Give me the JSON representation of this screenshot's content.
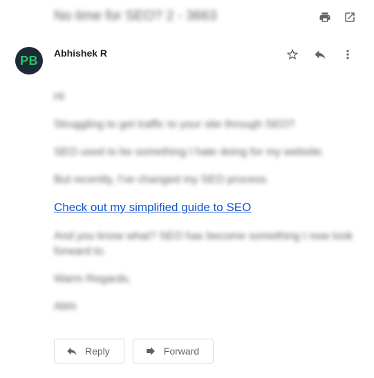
{
  "subject": "No time for SEO? 2 - 3663",
  "sender": {
    "name": "Abhishek R",
    "avatar_initials": "PB",
    "avatar_bg": "#1d2a35",
    "avatar_fg": "#23c46b"
  },
  "message": {
    "greeting": "Hi",
    "p1": "Struggling to get traffic to your site through SEO?",
    "p2": "SEO used to be something I hate doing for my website.",
    "p3": "But recently, I've changed my SEO process.",
    "link": "Check out my simplified guide to SEO",
    "p4": "And you know what? SEO has become something I now look forward to.",
    "signoff": "Warm Regards,",
    "signature": "Abhi"
  },
  "actions": {
    "reply_label": "Reply",
    "forward_label": "Forward"
  },
  "icons": [
    "print-icon",
    "open-in-new-icon",
    "star-icon",
    "reply-icon",
    "more-vert-icon",
    "forward-icon"
  ],
  "colors": {
    "link": "#1155cc",
    "icon": "#5f6368"
  }
}
